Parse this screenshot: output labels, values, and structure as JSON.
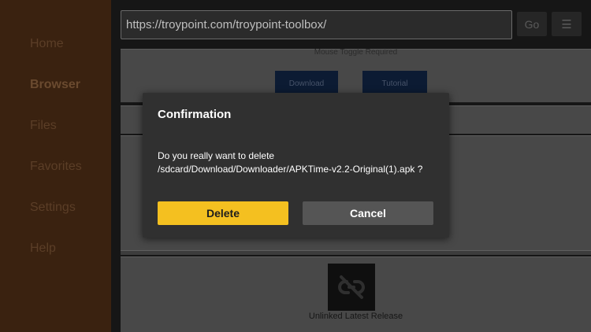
{
  "sidebar": {
    "items": [
      {
        "label": "Home"
      },
      {
        "label": "Browser",
        "active": true
      },
      {
        "label": "Files"
      },
      {
        "label": "Favorites"
      },
      {
        "label": "Settings"
      },
      {
        "label": "Help"
      }
    ]
  },
  "browser": {
    "url": "https://troypoint.com/troypoint-toolbox/",
    "go_label": "Go",
    "menu_icon": "menu-icon",
    "menu_glyph": "☰"
  },
  "web": {
    "mouse_note": "Mouse Toggle Required",
    "download_label": "Download",
    "tutorial_label": "Tutorial",
    "unlinked_icon": "unlinked-chain-icon",
    "unlinked_label": "Unlinked Latest Release"
  },
  "dialog": {
    "title": "Confirmation",
    "message": "Do you really want to delete /sdcard/Download/Downloader/APKTime-v2.2-Original(1).apk ?",
    "delete_label": "Delete",
    "cancel_label": "Cancel"
  },
  "colors": {
    "sidebar_bg": "#3a2210",
    "accent_yellow": "#f4c020",
    "dialog_bg": "#303030"
  }
}
